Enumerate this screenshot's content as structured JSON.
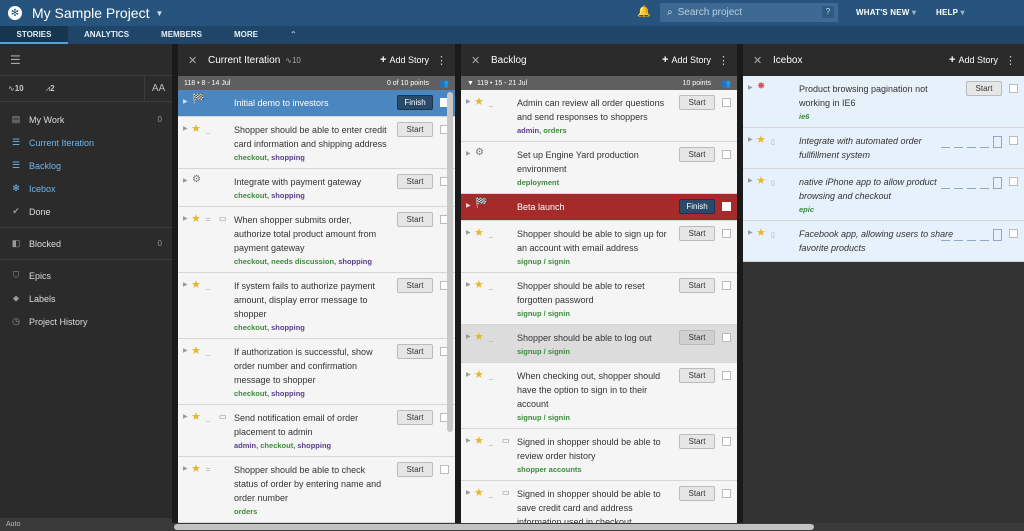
{
  "header": {
    "project_title": "My Sample Project",
    "search_placeholder": "Search project",
    "search_help": "?",
    "whats_new": "WHAT'S NEW",
    "help": "HELP"
  },
  "tabs": [
    {
      "label": "STORIES"
    },
    {
      "label": "ANALYTICS"
    },
    {
      "label": "MEMBERS"
    },
    {
      "label": "MORE"
    }
  ],
  "sidebar": {
    "velocity": "10",
    "volatility": "2",
    "text_size": "AA",
    "items": [
      {
        "label": "My Work",
        "count": "0"
      },
      {
        "label": "Current Iteration"
      },
      {
        "label": "Backlog"
      },
      {
        "label": "Icebox"
      },
      {
        "label": "Done"
      },
      {
        "label": "Blocked",
        "count": "0"
      },
      {
        "label": "Epics"
      },
      {
        "label": "Labels"
      },
      {
        "label": "Project History"
      }
    ],
    "auto": "Auto"
  },
  "panels": {
    "current": {
      "title": "Current Iteration",
      "velocity": "10",
      "add": "Add Story",
      "iteration": "118 • 8 - 14 Jul",
      "points": "0 of 10 points",
      "stories": [
        {
          "text": "Initial demo to investors",
          "button": "Finish",
          "labels": []
        },
        {
          "text": "Shopper should be able to enter credit card information and shipping address",
          "button": "Start",
          "labels": [
            "checkout",
            "shopping"
          ]
        },
        {
          "text": "Integrate with payment gateway",
          "button": "Start",
          "labels": [
            "checkout",
            "shopping"
          ]
        },
        {
          "text": "When shopper submits order, authorize total product amount from payment gateway",
          "button": "Start",
          "labels": [
            "checkout",
            "needs discussion",
            "shopping"
          ]
        },
        {
          "text": "If system fails to authorize payment amount, display error message to shopper",
          "button": "Start",
          "labels": [
            "checkout",
            "shopping"
          ]
        },
        {
          "text": "If authorization is successful, show order number and confirmation message to shopper",
          "button": "Start",
          "labels": [
            "checkout",
            "shopping"
          ]
        },
        {
          "text": "Send notification email of order placement to admin",
          "button": "Start",
          "labels": [
            "admin",
            "checkout",
            "shopping"
          ]
        },
        {
          "text": "Shopper should be able to check status of order by entering name and order number",
          "button": "Start",
          "labels": [
            "orders"
          ]
        }
      ]
    },
    "backlog": {
      "title": "Backlog",
      "add": "Add Story",
      "iteration": "119 • 15 - 21 Jul",
      "points": "10 points",
      "stories": [
        {
          "text": "Admin can review all order questions and send responses to shoppers",
          "button": "Start",
          "labels": [
            "admin",
            "orders"
          ]
        },
        {
          "text": "Set up Engine Yard production environment",
          "button": "Start",
          "labels": [
            "deployment"
          ]
        },
        {
          "text": "Beta launch",
          "button": "Finish",
          "labels": []
        },
        {
          "text": "Shopper should be able to sign up for an account with email address",
          "button": "Start",
          "labels": [
            "signup / signin"
          ]
        },
        {
          "text": "Shopper should be able to reset forgotten password",
          "button": "Start",
          "labels": [
            "signup / signin"
          ]
        },
        {
          "text": "Shopper should be able to log out",
          "button": "Start",
          "labels": [
            "signup / signin"
          ]
        },
        {
          "text": "When checking out, shopper should have the option to sign in to their account",
          "button": "Start",
          "labels": [
            "signup / signin"
          ]
        },
        {
          "text": "Signed in shopper should be able to review order history",
          "button": "Start",
          "labels": [
            "shopper accounts"
          ]
        },
        {
          "text": "Signed in shopper should be able to save credit card and address information used in checkout",
          "button": "Start",
          "labels": []
        }
      ]
    },
    "icebox": {
      "title": "Icebox",
      "add": "Add Story",
      "stories": [
        {
          "text": "Product browsing pagination not working in IE6",
          "button": "Start",
          "labels": [
            "ie6"
          ]
        },
        {
          "text": "Integrate with automated order fullfillment system",
          "labels": []
        },
        {
          "text": "native iPhone app to allow product browsing and checkout",
          "labels": [
            "epic"
          ]
        },
        {
          "text": "Facebook app, allowing users to share favorite products",
          "labels": []
        }
      ]
    }
  }
}
